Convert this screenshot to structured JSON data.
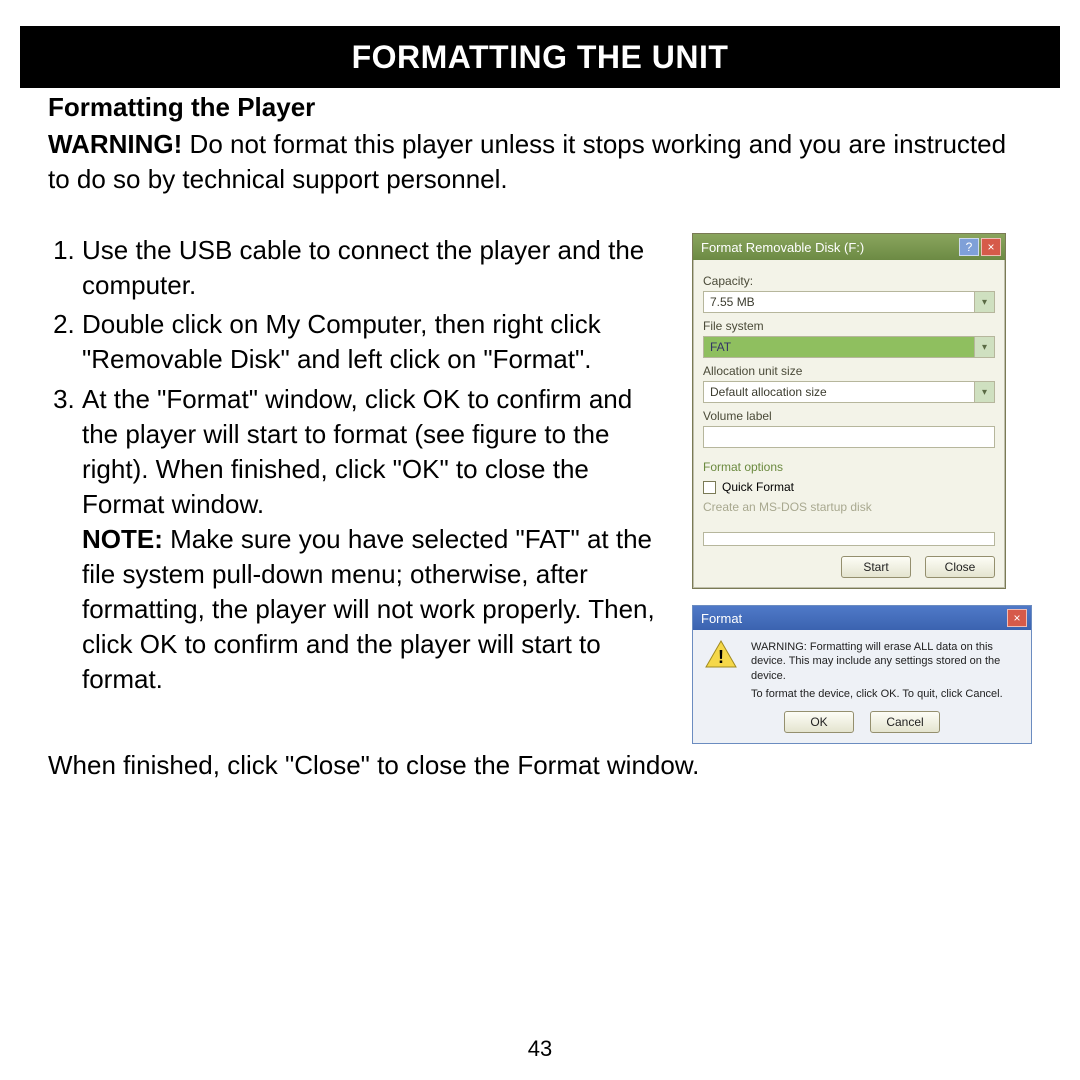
{
  "header": {
    "title": "FORMATTING THE UNIT"
  },
  "section": {
    "subhead": "Formatting the Player",
    "warning_label": "WARNING!",
    "warning_text": " Do not format this player unless it stops working and you are instructed to do so by technical support personnel.",
    "steps": [
      "Use the USB cable to connect the player and the computer.",
      "Double click on My Computer, then right click \"Removable Disk\" and left click on \"Format\".",
      "At the \"Format\" window, click OK to confirm and the player will start to format (see figure to the right). When finished, click \"OK\" to close the Format window."
    ],
    "note_label": "NOTE:",
    "note_text": " Make sure you have selected \"FAT\" at the file system pull-down menu; otherwise, after formatting, the player will not work properly. Then, click OK to confirm and the player will start to format.",
    "tail": "When finished, click \"Close\" to close the Format window."
  },
  "format_dialog": {
    "title": "Format Removable Disk (F:)",
    "labels": {
      "capacity": "Capacity:",
      "filesystem": "File system",
      "allocation": "Allocation unit size",
      "volume": "Volume label",
      "options": "Format options",
      "quickformat": "Quick Format",
      "dim": "Create an MS-DOS startup disk"
    },
    "values": {
      "capacity": "7.55 MB",
      "filesystem": "FAT",
      "allocation": "Default allocation size"
    },
    "buttons": {
      "start": "Start",
      "close": "Close"
    }
  },
  "warn_dialog": {
    "title": "Format",
    "line1": "WARNING: Formatting will erase ALL data on this device. This may include any settings stored on the device.",
    "line2": "To format the device, click OK. To quit, click Cancel.",
    "buttons": {
      "ok": "OK",
      "cancel": "Cancel"
    }
  },
  "page_number": "43"
}
